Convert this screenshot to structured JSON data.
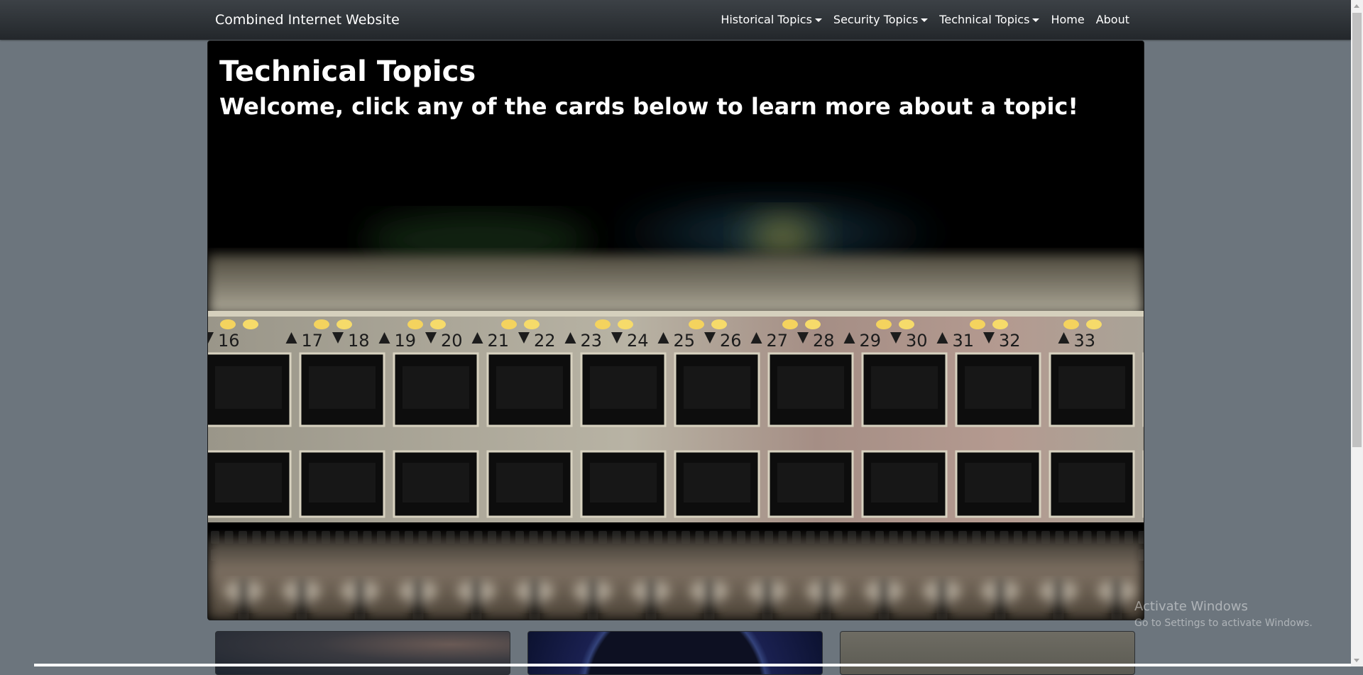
{
  "navbar": {
    "brand": "Combined Internet Website",
    "items": [
      {
        "label": "Historical Topics",
        "dropdown": true
      },
      {
        "label": "Security Topics",
        "dropdown": true
      },
      {
        "label": "Technical Topics",
        "dropdown": true
      },
      {
        "label": "Home",
        "dropdown": false
      },
      {
        "label": "About",
        "dropdown": false
      }
    ]
  },
  "hero": {
    "title": "Technical Topics",
    "subtitle": "Welcome, click any of the cards below to learn more about a topic!",
    "image_subject": "network-switch-ports-photo",
    "port_numbers": [
      "16",
      "17",
      "18",
      "19",
      "20",
      "21",
      "22",
      "23",
      "24",
      "25",
      "26",
      "27",
      "28",
      "29",
      "30",
      "31",
      "32",
      "33"
    ]
  },
  "watermark": {
    "title": "Activate Windows",
    "subtitle": "Go to Settings to activate Windows."
  },
  "colors": {
    "page_background": "#6c757d",
    "navbar": "#343a40",
    "hero_background": "#000000"
  }
}
